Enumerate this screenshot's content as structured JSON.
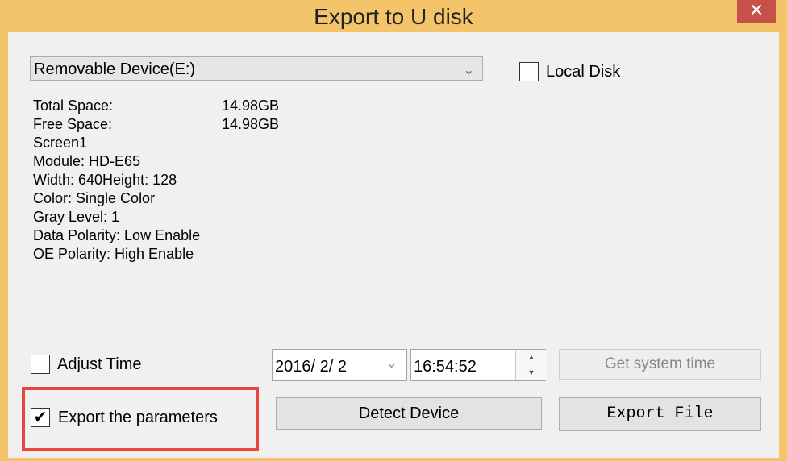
{
  "window": {
    "title": "Export to U disk",
    "close_glyph": "✕"
  },
  "device_select": {
    "value": "Removable Device(E:)",
    "arrow_icon": "chevron-down-icon"
  },
  "local_disk": {
    "label": "Local Disk",
    "checked": false
  },
  "info": {
    "total_space_label": "Total Space:",
    "total_space_value": "14.98GB",
    "free_space_label": "Free Space:",
    "free_space_value": "14.98GB",
    "lines": [
      "Screen1",
      "Module: HD-E65",
      "Width: 640Height: 128",
      "Color: Single Color",
      "Gray Level: 1",
      "Data Polarity: Low Enable",
      "OE Polarity: High Enable"
    ]
  },
  "adjust_time": {
    "label": "Adjust Time",
    "checked": false
  },
  "date_field": {
    "value": "2016/ 2/ 2",
    "arrow": "⌄"
  },
  "time_field": {
    "value": "16:54:52",
    "up": "▲",
    "down": "▼"
  },
  "buttons": {
    "get_system_time": "Get system time",
    "detect_device": "Detect Device",
    "export_file": "Export File"
  },
  "export_params": {
    "label": "Export the parameters",
    "checked": true,
    "check_glyph": "✔"
  },
  "colors": {
    "title_bar": "#f4c46b",
    "close_button": "#c7504b",
    "highlight_border": "#e8453c",
    "client_bg": "#f0f0f0"
  }
}
